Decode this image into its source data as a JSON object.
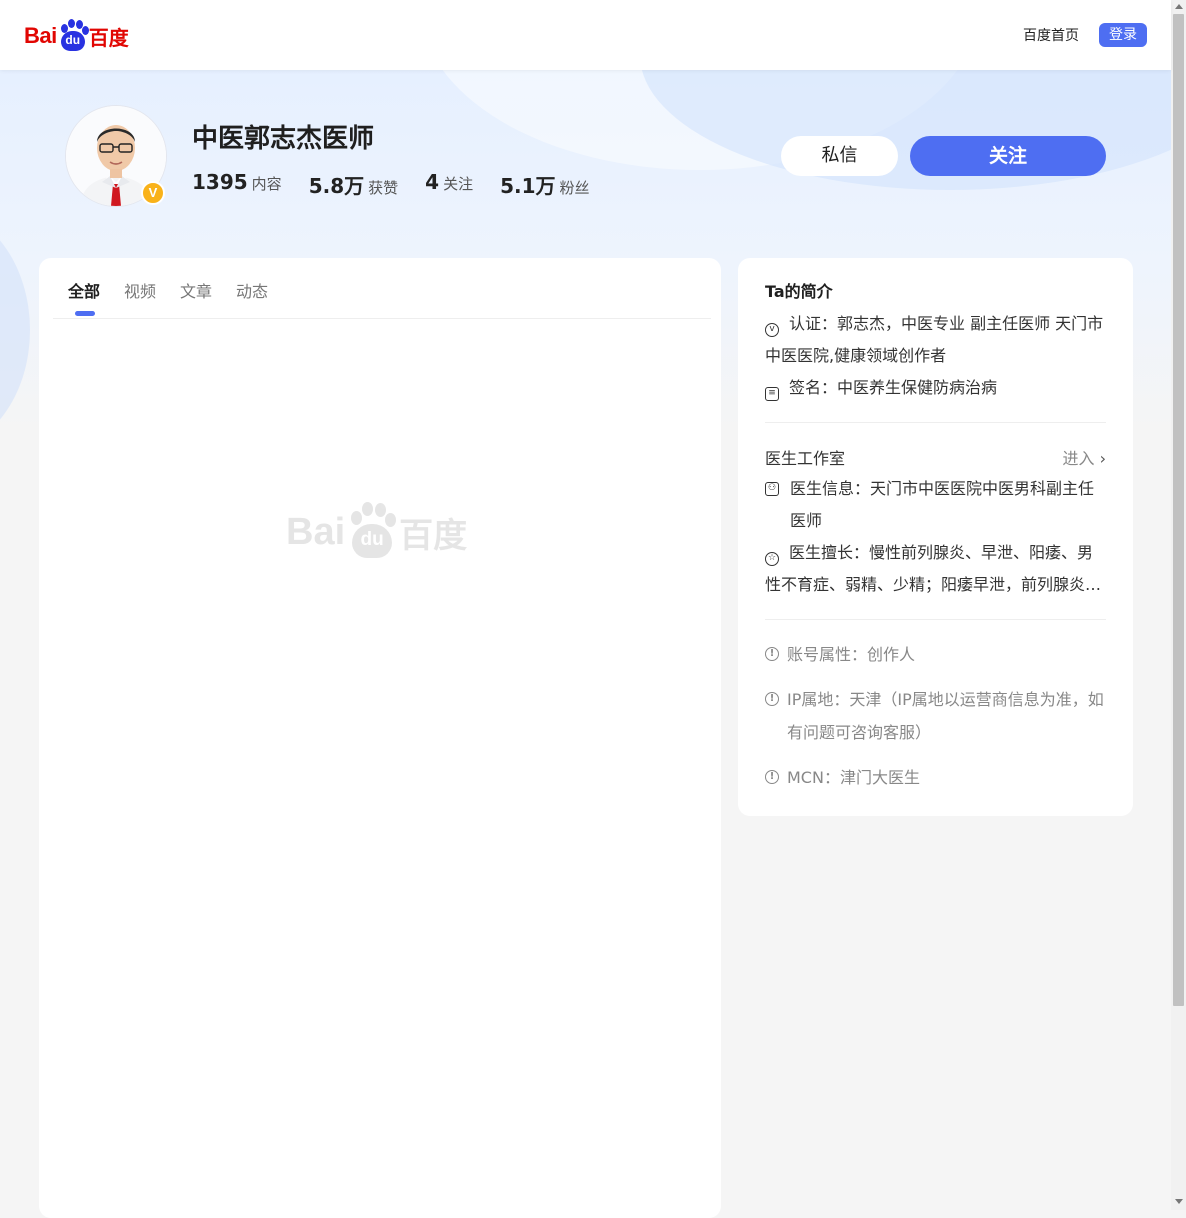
{
  "header": {
    "logo_text_latin": "Bai",
    "logo_text_paw": "du",
    "logo_text_cn": "百度",
    "home_link": "百度首页",
    "login_label": "登录"
  },
  "profile": {
    "name": "中医郭志杰医师",
    "verified_mark": "V",
    "stats": [
      {
        "num": "1395",
        "label": "内容"
      },
      {
        "num": "5.8万",
        "label": "获赞"
      },
      {
        "num": "4",
        "label": "关注"
      },
      {
        "num": "5.1万",
        "label": "粉丝"
      }
    ],
    "message_label": "私信",
    "follow_label": "关注"
  },
  "tabs": [
    {
      "label": "全部",
      "active": true
    },
    {
      "label": "视频",
      "active": false
    },
    {
      "label": "文章",
      "active": false
    },
    {
      "label": "动态",
      "active": false
    }
  ],
  "intro": {
    "title": "Ta的简介",
    "certification": "认证：郭志杰，中医专业 副主任医师 天门市中医医院,健康领域创作者",
    "signature": "签名：中医养生保健防病治病"
  },
  "studio": {
    "title": "医生工作室",
    "enter_label": "进入",
    "doctor_info": "医生信息：天门市中医医院中医男科副主任医师",
    "specialty": "医生擅长：慢性前列腺炎、早泄、阳痿、男性不育症、弱精、少精；阳痿早泄，前列腺炎，男性不育症"
  },
  "account": {
    "attribute": "账号属性：创作人",
    "ip": "IP属地：天津（IP属地以运营商信息为准，如有问题可咨询客服）",
    "mcn": "MCN：津门大医生"
  },
  "colors": {
    "accent": "#4e6ef2",
    "baidu_red": "#e10602",
    "baidu_blue": "#2932e1",
    "badge_gold": "#f9b21a"
  }
}
